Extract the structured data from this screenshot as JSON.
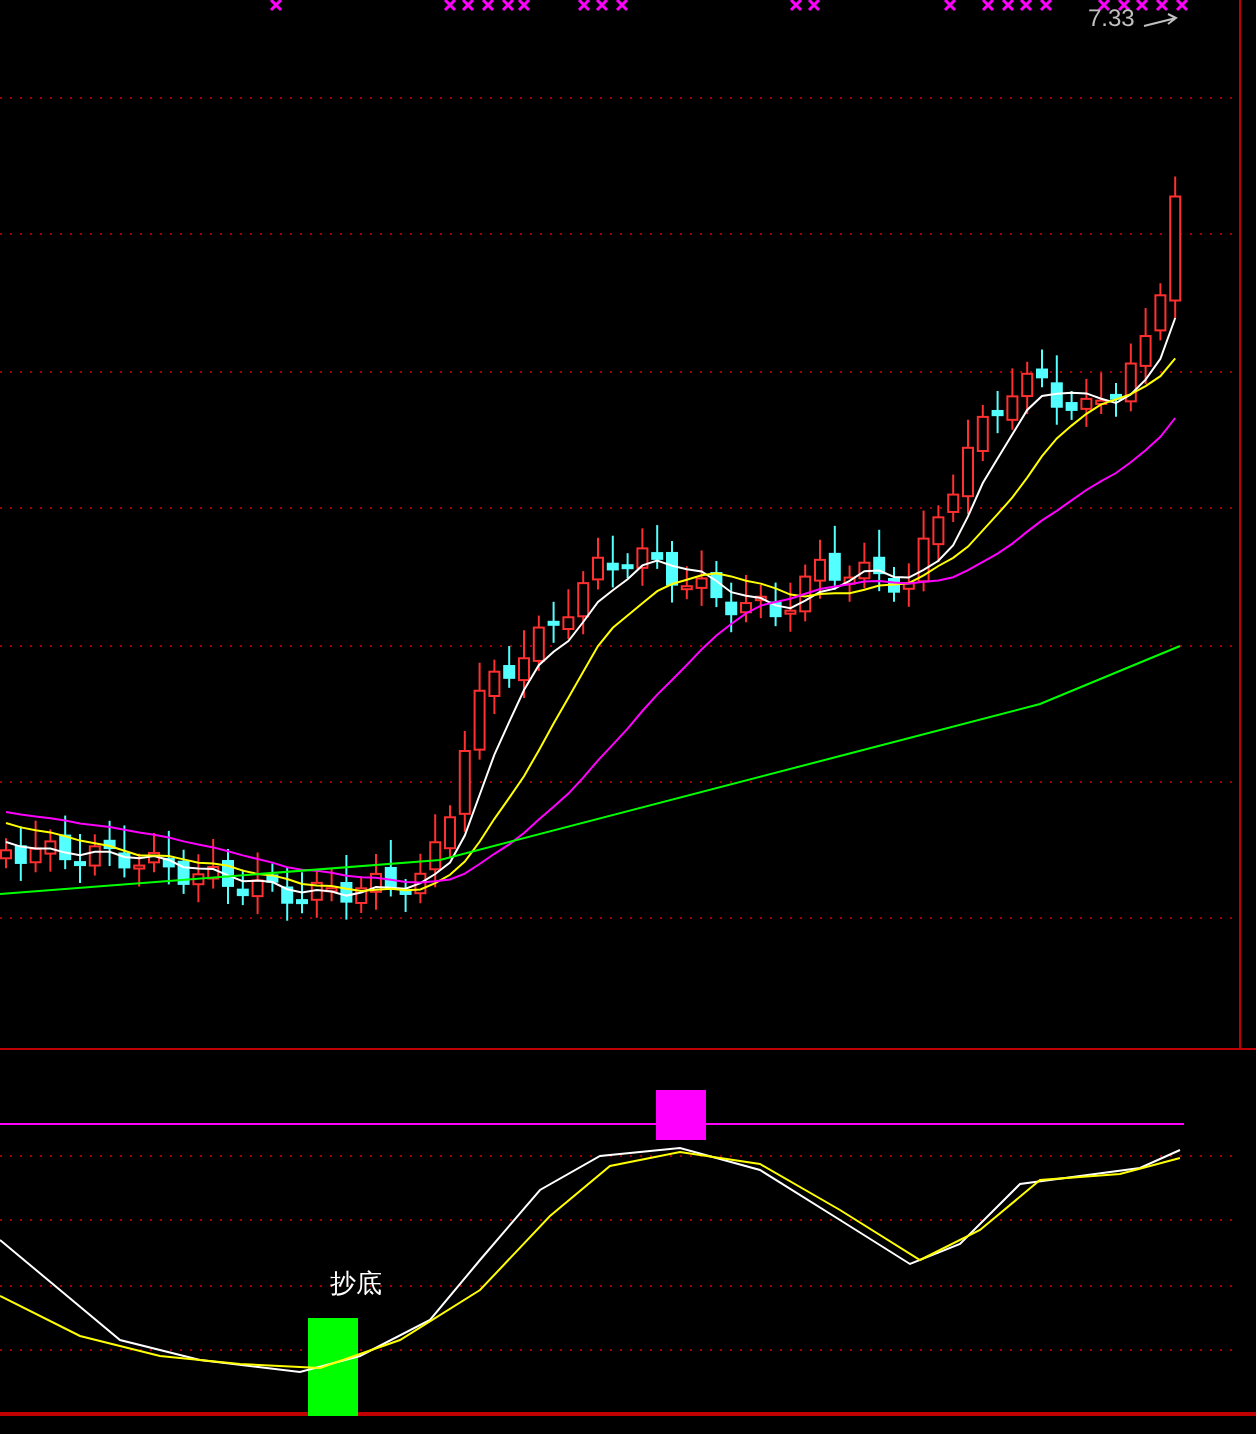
{
  "price_chart": {
    "high_label": "7.33"
  },
  "indicator": {
    "signal_label": "抄底"
  }
}
